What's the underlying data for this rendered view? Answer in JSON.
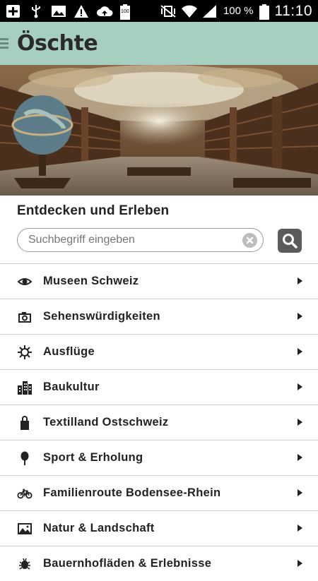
{
  "status_bar": {
    "battery_percent": "100 %",
    "time": "11:10",
    "battery_badge": "100"
  },
  "app_bar": {
    "logo": "Öschte"
  },
  "section_title": "Entdecken und Erleben",
  "search": {
    "placeholder": "Suchbegriff eingeben"
  },
  "list": {
    "items": [
      {
        "label": "Museen Schweiz",
        "icon": "eye-icon"
      },
      {
        "label": "Sehenswürdigkeiten",
        "icon": "camera-icon"
      },
      {
        "label": "Ausflüge",
        "icon": "compass-icon"
      },
      {
        "label": "Baukultur",
        "icon": "buildings-icon"
      },
      {
        "label": "Textilland Ostschweiz",
        "icon": "bag-icon"
      },
      {
        "label": "Sport & Erholung",
        "icon": "tree-icon"
      },
      {
        "label": "Familienroute Bodensee-Rhein",
        "icon": "bicycle-icon"
      },
      {
        "label": "Natur & Landschaft",
        "icon": "landscape-icon"
      },
      {
        "label": "Bauernhofläden & Erlebnisse",
        "icon": "bug-icon"
      }
    ]
  },
  "colors": {
    "app_bar": "#a7cfc0",
    "search_button": "#5b5b5b"
  }
}
